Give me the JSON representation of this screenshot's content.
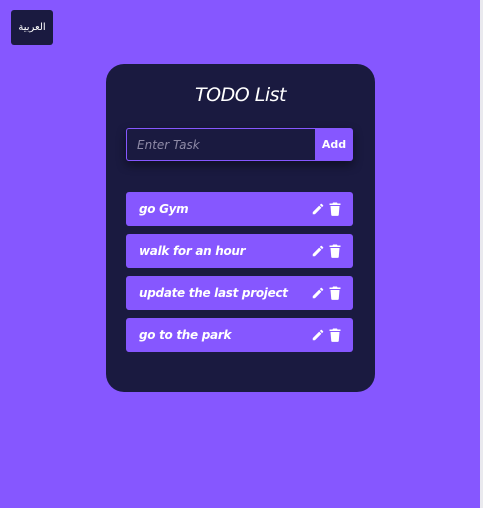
{
  "language_button": {
    "label": "العربية"
  },
  "app": {
    "title": "TODO List",
    "input": {
      "placeholder": "Enter Task",
      "value": ""
    },
    "add_label": "Add"
  },
  "todos": [
    {
      "text": "go Gym"
    },
    {
      "text": "walk for an hour"
    },
    {
      "text": "update the last project"
    },
    {
      "text": "go to the park"
    }
  ],
  "colors": {
    "background": "#8657ff",
    "card": "#1a1a40",
    "accent": "#8657ff",
    "text": "#ffffff"
  },
  "icons": {
    "edit": "pencil-icon",
    "delete": "trash-icon"
  }
}
